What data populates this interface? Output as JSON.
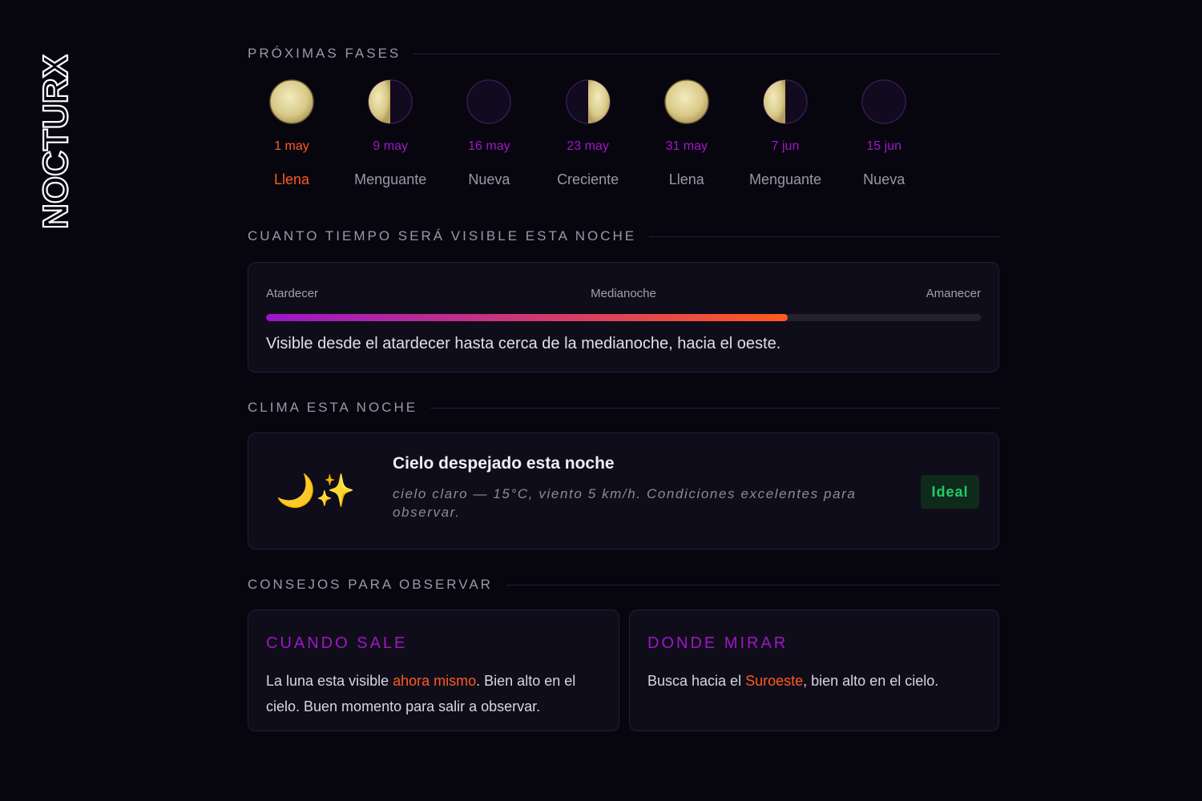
{
  "brand": {
    "logo_text": "NOCTURX"
  },
  "sections": {
    "phases": "PRÓXIMAS FASES",
    "visibility": "CUANTO TIEMPO SERÁ VISIBLE ESTA NOCHE",
    "weather": "CLIMA ESTA NOCHE",
    "tips": "CONSEJOS PARA OBSERVAR"
  },
  "phases": [
    {
      "date": "1 may",
      "name": "Llena",
      "shape": "full",
      "current": true
    },
    {
      "date": "9 may",
      "name": "Menguante",
      "shape": "left-lit",
      "current": false
    },
    {
      "date": "16 may",
      "name": "Nueva",
      "shape": "new",
      "current": false
    },
    {
      "date": "23 may",
      "name": "Creciente",
      "shape": "right-lit",
      "current": false
    },
    {
      "date": "31 may",
      "name": "Llena",
      "shape": "full",
      "current": false
    },
    {
      "date": "7 jun",
      "name": "Menguante",
      "shape": "left-lit",
      "current": false
    },
    {
      "date": "15 jun",
      "name": "Nueva",
      "shape": "new",
      "current": false
    }
  ],
  "visibility": {
    "start_label": "Atardecer",
    "mid_label": "Medianoche",
    "end_label": "Amanecer",
    "fill_fraction": 0.73,
    "description": "Visible desde el atardecer hasta cerca de la medianoche, hacia el oeste."
  },
  "weather": {
    "icons": "🌙✨",
    "title": "Cielo despejado esta noche",
    "description": "cielo claro — 15°C, viento 5 km/h. Condiciones excelentes para observar.",
    "badge": "Ideal"
  },
  "tips": {
    "when": {
      "title": "CUANDO SALE",
      "text_before": "La luna esta visible ",
      "highlight": "ahora mismo",
      "text_after": ". Bien alto en el cielo. Buen momento para salir a observar."
    },
    "where": {
      "title": "DONDE MIRAR",
      "text_before": "Busca hacia el ",
      "highlight": "Suroeste",
      "text_after": ", bien alto en el cielo."
    }
  },
  "colors": {
    "background": "#07060f",
    "accent_purple": "#a116c8",
    "accent_orange": "#ff5a1f",
    "ideal_green": "#1fce68",
    "moon_gold": "#e6dca0"
  }
}
